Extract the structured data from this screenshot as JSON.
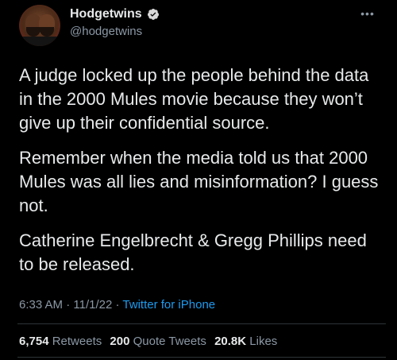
{
  "author": {
    "display_name": "Hodgetwins",
    "handle": "@hodgetwins",
    "verified": true
  },
  "tweet": {
    "paragraphs": [
      "A judge locked up the people behind the data in the 2000 Mules movie because they won’t give up their confidential source.",
      "Remember when the media told us that 2000 Mules was all lies and misinformation? I guess not.",
      "Catherine Engelbrecht & Gregg Phillips need to be released."
    ],
    "time": "6:33 AM",
    "date": "11/1/22",
    "source": "Twitter for iPhone"
  },
  "stats": {
    "retweets_count": "6,754",
    "retweets_label": "Retweets",
    "quotes_count": "200",
    "quotes_label": "Quote Tweets",
    "likes_count": "20.8K",
    "likes_label": "Likes"
  },
  "icons": {
    "verified": "verified-badge-icon",
    "more": "more-options-icon"
  },
  "colors": {
    "background": "#000000",
    "text_primary": "#e7e9ea",
    "text_secondary": "#8b98a5",
    "link": "#1d9bf0",
    "divider": "#2f3336"
  }
}
